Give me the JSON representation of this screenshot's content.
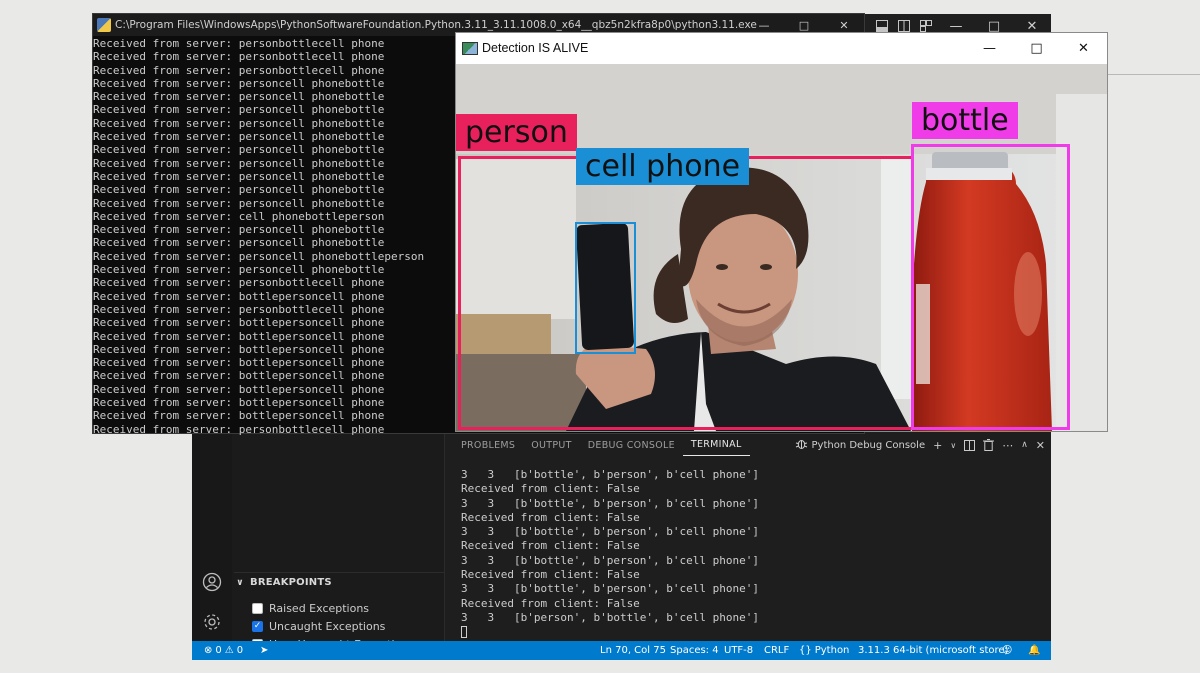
{
  "console": {
    "title": "C:\\Program Files\\WindowsApps\\PythonSoftwareFoundation.Python.3.11_3.11.1008.0_x64__qbz5n2kfra8p0\\python3.11.exe",
    "lines": [
      "Received from server: personbottlecell phone",
      "Received from server: personbottlecell phone",
      "Received from server: personbottlecell phone",
      "Received from server: personcell phonebottle",
      "Received from server: personcell phonebottle",
      "Received from server: personcell phonebottle",
      "Received from server: personcell phonebottle",
      "Received from server: personcell phonebottle",
      "Received from server: personcell phonebottle",
      "Received from server: personcell phonebottle",
      "Received from server: personcell phonebottle",
      "Received from server: personcell phonebottle",
      "Received from server: personcell phonebottle",
      "Received from server: cell phonebottleperson",
      "Received from server: personcell phonebottle",
      "Received from server: personcell phonebottle",
      "Received from server: personcell phonebottleperson",
      "Received from server: personcell phonebottle",
      "Received from server: personbottlecell phone",
      "Received from server: bottlepersoncell phone",
      "Received from server: personbottlecell phone",
      "Received from server: bottlepersoncell phone",
      "Received from server: bottlepersoncell phone",
      "Received from server: bottlepersoncell phone",
      "Received from server: bottlepersoncell phone",
      "Received from server: bottlepersoncell phone",
      "Received from server: bottlepersoncell phone",
      "Received from server: bottlepersoncell phone",
      "Received from server: bottlepersoncell phone",
      "Received from server: personbottlecell phone"
    ]
  },
  "detection": {
    "title": "Detection IS ALIVE",
    "labels": {
      "person": "person",
      "cell_phone": "cell phone",
      "bottle": "bottle"
    },
    "colors": {
      "person": "#e8215c",
      "cell_phone": "#1a8fd6",
      "bottle": "#f03be8"
    }
  },
  "vscode": {
    "tabs": [
      "PROBLEMS",
      "OUTPUT",
      "DEBUG CONSOLE",
      "TERMINAL"
    ],
    "active_tab": "TERMINAL",
    "debug_console_label": "Python Debug Console",
    "terminal_lines": [
      "3   3   [b'bottle', b'person', b'cell phone']",
      "Received from client: False",
      "3   3   [b'bottle', b'person', b'cell phone']",
      "Received from client: False",
      "3   3   [b'bottle', b'person', b'cell phone']",
      "Received from client: False",
      "3   3   [b'bottle', b'person', b'cell phone']",
      "Received from client: False",
      "3   3   [b'bottle', b'person', b'cell phone']",
      "Received from client: False",
      "3   3   [b'person', b'bottle', b'cell phone']"
    ],
    "breakpoints": {
      "header": "BREAKPOINTS",
      "items": [
        {
          "label": "Raised Exceptions",
          "checked": false
        },
        {
          "label": "Uncaught Exceptions",
          "checked": true
        },
        {
          "label": "User Uncaught Exceptions",
          "checked": false
        }
      ]
    },
    "status": {
      "errors": "0",
      "warnings": "0",
      "position": "Ln 70, Col 75",
      "spaces": "Spaces: 4",
      "encoding": "UTF-8",
      "eol": "CRLF",
      "language": "Python",
      "interpreter": "3.11.3 64-bit (microsoft store)",
      "accent": "#007acc"
    }
  }
}
